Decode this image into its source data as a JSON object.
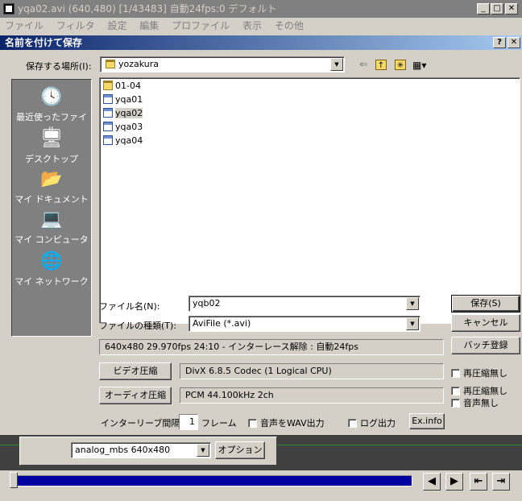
{
  "app": {
    "title": "yqa02.avi (640,480) [1/43483] 自動24fps:0 デフォルト",
    "menu": [
      "ファイル",
      "フィルタ",
      "設定",
      "編集",
      "プロファイル",
      "表示",
      "その他"
    ]
  },
  "dialog": {
    "title": "名前を付けて保存",
    "help": "?",
    "close": "✕",
    "location_label": "保存する場所(I):",
    "location_value": "yozakura",
    "places": [
      "最近使ったファイル",
      "デスクトップ",
      "マイ ドキュメント",
      "マイ コンピュータ",
      "マイ ネットワーク"
    ],
    "files": [
      {
        "name": "01-04",
        "type": "folder"
      },
      {
        "name": "yqa01",
        "type": "file"
      },
      {
        "name": "yqa02",
        "type": "file",
        "selected": true
      },
      {
        "name": "yqa03",
        "type": "file"
      },
      {
        "name": "yqa04",
        "type": "file"
      }
    ],
    "filename_label": "ファイル名(N):",
    "filename_value": "yqb02",
    "filetype_label": "ファイルの種類(T):",
    "filetype_value": "AviFile (*.avi)",
    "save_button": "保存(S)",
    "cancel_button": "キャンセル",
    "batch_button": "バッチ登録",
    "info_text": "640x480 29.970fps 24:10 - インターレース解除 : 自動24fps",
    "video_button": "ビデオ圧縮",
    "video_codec": "DivX 6.8.5 Codec (1 Logical CPU)",
    "audio_button": "オーディオ圧縮",
    "audio_codec": "PCM 44.100kHz 2ch",
    "no_recompress_video": "再圧縮無し",
    "no_recompress_audio": "再圧縮無し",
    "no_audio": "音声無し",
    "interleave_label": "インターリーブ間隔 :",
    "interleave_value": "1",
    "frame_unit": "フレーム",
    "wav_output": "音声をWAV出力",
    "log_output": "ログ出力",
    "exinfo_button": "Ex.info"
  },
  "bottom": {
    "plugin_value": "analog_mbs 640x480",
    "option_button": "オプション",
    "progress": 1.0
  }
}
